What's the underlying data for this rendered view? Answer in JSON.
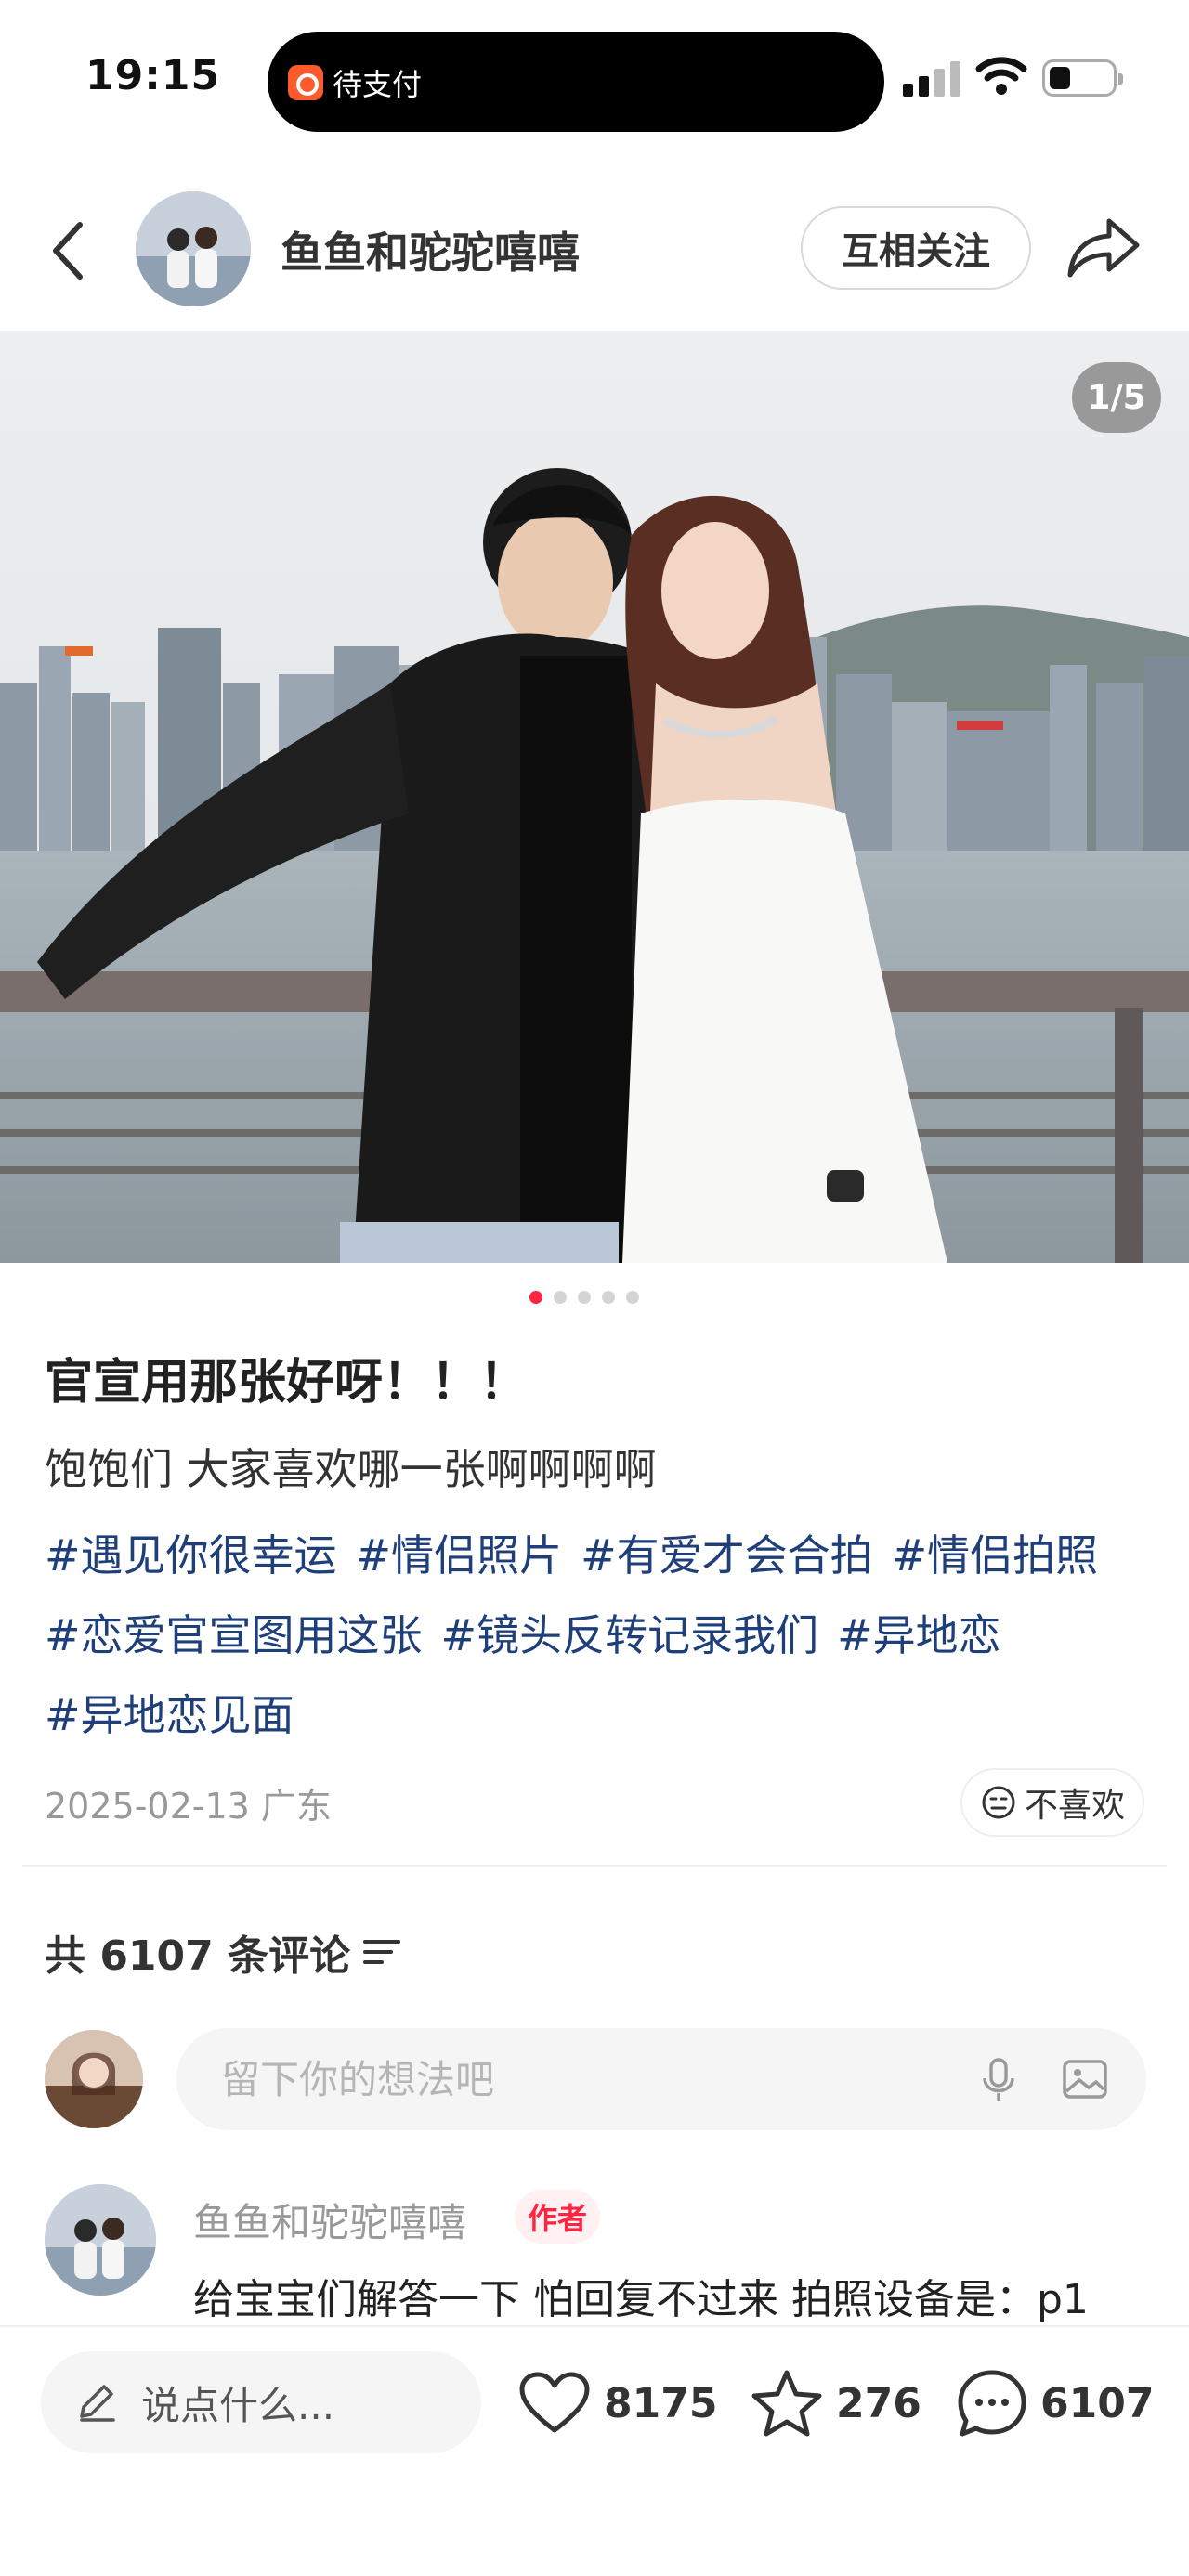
{
  "status_bar": {
    "time": "19:15",
    "activity_label": "待支付"
  },
  "header": {
    "author_name": "鱼鱼和驼驼嘻嘻",
    "follow_label": "互相关注"
  },
  "gallery": {
    "page_indicator": "1/5",
    "current_page": 1,
    "total_pages": 5
  },
  "post": {
    "title": "官宣用那张好呀！！！",
    "body": "饱饱们 大家喜欢哪一张啊啊啊啊",
    "tags": [
      "#遇见你很幸运",
      "#情侣照片",
      "#有爱才会合拍",
      "#情侣拍照",
      "#恋爱官宣图用这张",
      "#镜头反转记录我们",
      "#异地恋",
      "#异地恋见面"
    ],
    "date_location": "2025-02-13 广东",
    "dislike_label": "不喜欢"
  },
  "comments": {
    "count_label": "共 6107 条评论",
    "input_placeholder": "留下你的想法吧",
    "first_comment": {
      "author": "鱼鱼和驼驼嘻嘻",
      "badge": "作者",
      "text": "给宝宝们解答一下 怕回复不过来 拍照设备是：p1"
    }
  },
  "bottom_bar": {
    "input_label": "说点什么...",
    "likes": "8175",
    "favorites": "276",
    "comments": "6107"
  },
  "colors": {
    "accent": "#ff2442",
    "tag": "#1f3f7a",
    "meta": "#999999"
  },
  "icons": [
    "back-arrow-icon",
    "share-icon",
    "dislike-face-icon",
    "filter-icon",
    "microphone-icon",
    "image-icon",
    "pencil-icon",
    "heart-icon",
    "star-icon",
    "comment-bubble-icon"
  ]
}
